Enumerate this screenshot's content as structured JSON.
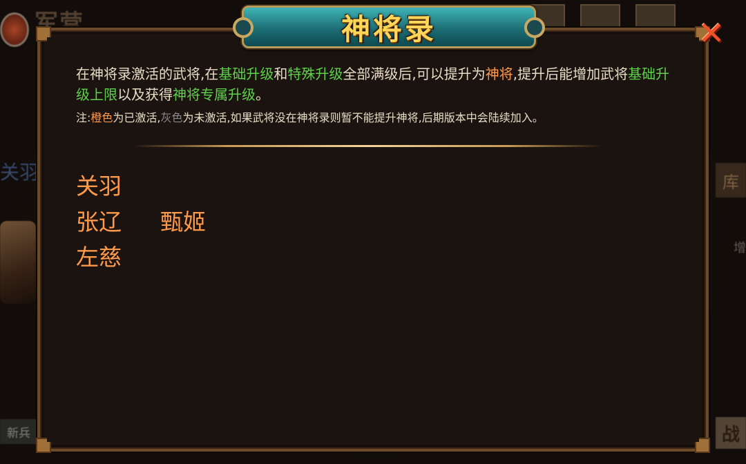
{
  "dialog": {
    "title": "神将录",
    "description": {
      "p1": "在神将录激活的武将,在",
      "h1": "基础升级",
      "p2": "和",
      "h2": "特殊升级",
      "p3": "全部满级后,可以提升为",
      "h3": "神将",
      "p4": ",提升后能增加武将",
      "h4": "基础升级上限",
      "p5": "以及获得",
      "h5": "神将专属升级",
      "p6": "。"
    },
    "note": {
      "prefix": "注:",
      "orange_word": "橙色",
      "mid1": "为已激活,",
      "gray_word": "灰色",
      "rest": "为未激活,如果武将没在神将录则暂不能提升神将,后期版本中会陆续加入。"
    },
    "heroes": [
      "关羽",
      "张辽",
      "甄姬",
      "左慈"
    ],
    "colors": {
      "activated": "#ff9a4a",
      "inactive": "#8a8a8a",
      "highlight": "#5ed24a"
    }
  },
  "background": {
    "title_fragment": "军营",
    "name_fragment": "关羽",
    "side_tab": "库",
    "side_text": "增",
    "bottom_left": "新兵",
    "bottom_right": "战"
  }
}
